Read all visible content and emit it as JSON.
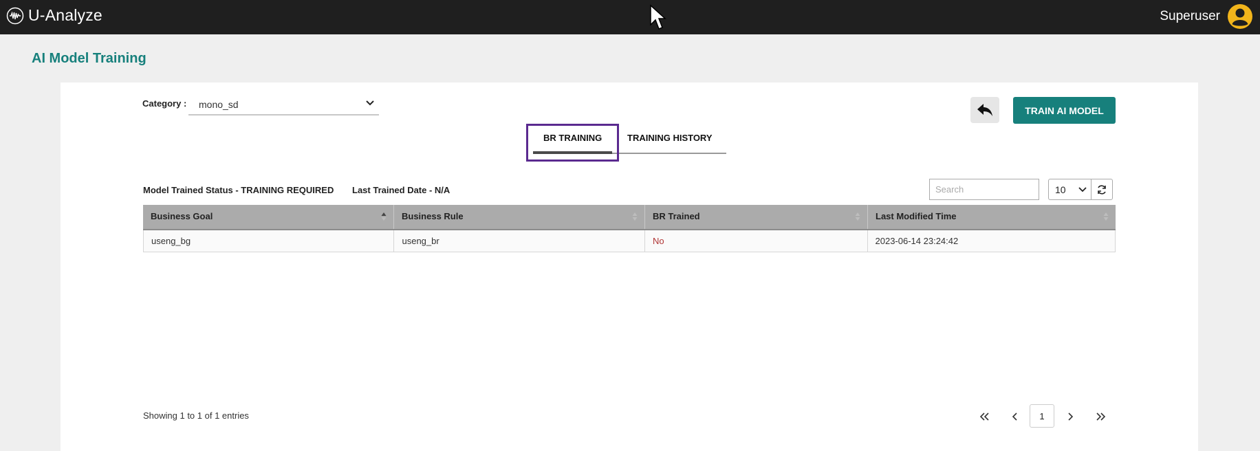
{
  "header": {
    "brand": "U-Analyze",
    "user": "Superuser"
  },
  "page": {
    "title": "AI Model Training"
  },
  "category": {
    "label": "Category :",
    "value": "mono_sd"
  },
  "actions": {
    "train_label": "TRAIN AI MODEL"
  },
  "tabs": [
    {
      "label": "BR TRAINING",
      "active": true
    },
    {
      "label": "TRAINING HISTORY",
      "active": false
    }
  ],
  "status": {
    "model_trained": "Model Trained Status - TRAINING REQUIRED",
    "last_trained": "Last Trained Date - N/A"
  },
  "table_controls": {
    "search_placeholder": "Search",
    "page_size": "10"
  },
  "table": {
    "columns": [
      "Business Goal",
      "Business Rule",
      "BR Trained",
      "Last Modified Time"
    ],
    "rows": [
      [
        "useng_bg",
        "useng_br",
        "No",
        "2023-06-14 23:24:42"
      ]
    ]
  },
  "pagination": {
    "showing": "Showing 1 to 1 of 1 entries",
    "current_page": "1"
  },
  "colors": {
    "accent": "#17807c",
    "topbar": "#1f1f1f",
    "highlight_box": "#5a2a8f",
    "avatar": "#f2b51b",
    "status_no": "#b03535"
  },
  "icons": {
    "brand": "waveform-icon",
    "avatar": "user-circle-icon",
    "back": "reply-arrow-icon",
    "refresh": "refresh-icon"
  }
}
